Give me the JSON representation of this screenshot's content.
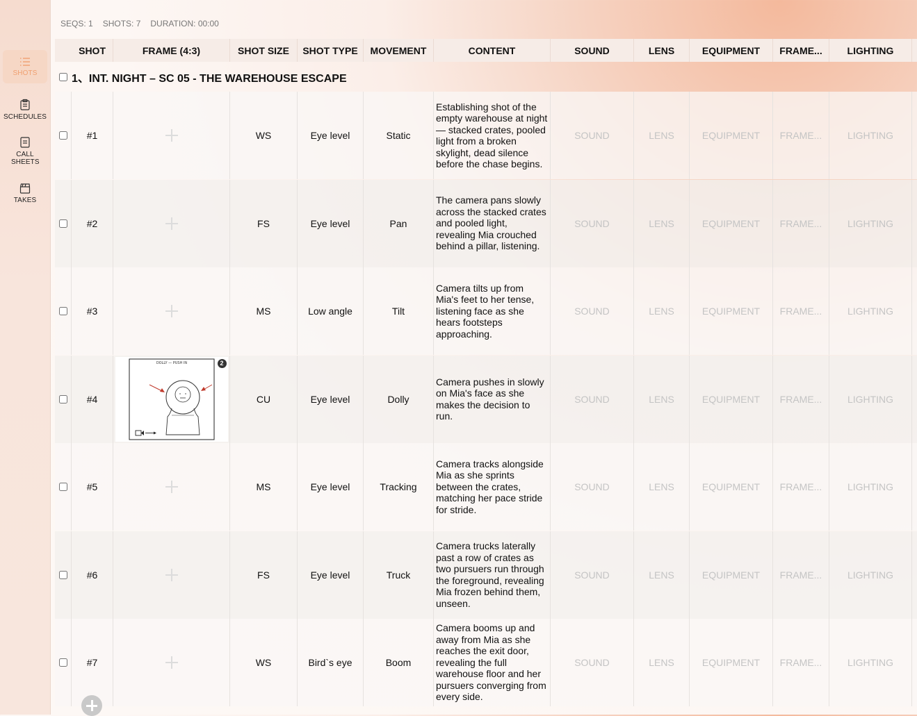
{
  "sidebar": {
    "items": [
      {
        "label": "SHOTS",
        "icon": "list-icon",
        "active": true
      },
      {
        "label": "SCHEDULES",
        "icon": "clipboard-icon"
      },
      {
        "label": "CALL SHEETS",
        "icon": "sheet-icon"
      },
      {
        "label": "TAKES",
        "icon": "clapperboard-icon"
      }
    ]
  },
  "stats": {
    "seqs": "SEQS: 1",
    "shots": "SHOTS: 7",
    "duration": "DURATION: 00:00"
  },
  "columns": [
    "SHOT",
    "FRAME (4:3)",
    "SHOT SIZE",
    "SHOT TYPE",
    "MOVEMENT",
    "CONTENT",
    "SOUND",
    "LENS",
    "EQUIPMENT",
    "FRAME...",
    "LIGHTING"
  ],
  "scene": {
    "title": "1、INT. NIGHT – SC 05 - THE WAREHOUSE ESCAPE"
  },
  "placeholders": {
    "sound": "SOUND",
    "lens": "LENS",
    "equipment": "EQUIPMENT",
    "frame": "FRAME...",
    "lighting": "LIGHTING"
  },
  "frame_image": {
    "caption": "DOLLY — PUSH IN",
    "badge": "2"
  },
  "shots": [
    {
      "shot": "#1",
      "size": "WS",
      "type": "Eye level",
      "movement": "Static",
      "content": "Establishing shot of the empty warehouse at night — stacked crates, pooled light from a broken skylight, dead silence before the chase begins.",
      "has_frame": false
    },
    {
      "shot": "#2",
      "size": "FS",
      "type": "Eye level",
      "movement": "Pan",
      "content": "The camera pans slowly across the stacked crates and pooled light, revealing Mia crouched behind a pillar, listening.",
      "has_frame": false
    },
    {
      "shot": "#3",
      "size": "MS",
      "type": "Low angle",
      "movement": "Tilt",
      "content": "Camera tilts up from Mia's feet to her tense, listening face as she hears footsteps approaching.",
      "has_frame": false
    },
    {
      "shot": "#4",
      "size": "CU",
      "type": "Eye level",
      "movement": "Dolly",
      "content": "Camera pushes in slowly on Mia's face as she makes the decision to run.",
      "has_frame": true
    },
    {
      "shot": "#5",
      "size": "MS",
      "type": "Eye level",
      "movement": "Tracking",
      "content": "Camera tracks alongside Mia as she sprints between the crates, matching her pace stride for stride.",
      "has_frame": false
    },
    {
      "shot": "#6",
      "size": "FS",
      "type": "Eye level",
      "movement": "Truck",
      "content": "Camera trucks laterally past a row of crates as two pursuers run through the foreground, revealing Mia frozen behind them, unseen.",
      "has_frame": false
    },
    {
      "shot": "#7",
      "size": "WS",
      "type": "Bird`s eye",
      "movement": "Boom",
      "content": "Camera booms up and away from Mia as she reaches the exit door, revealing the full warehouse floor and her pursuers converging from every side.",
      "has_frame": false
    }
  ]
}
